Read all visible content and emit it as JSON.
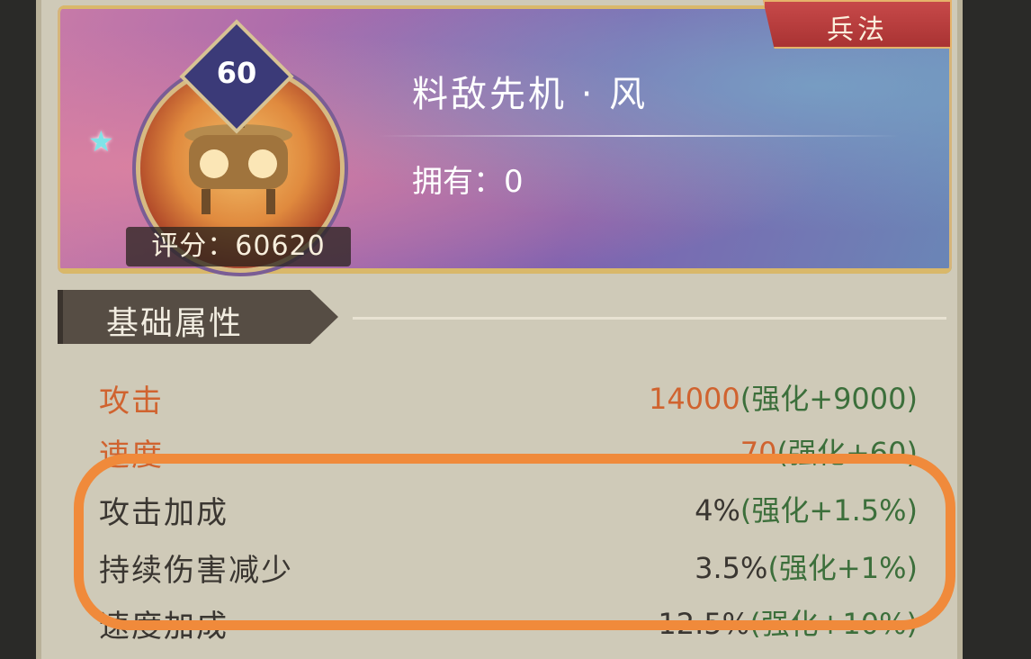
{
  "header": {
    "tag_label": "兵法",
    "level": "60",
    "score_label": "评分：60620",
    "title": "料敌先机 · 风",
    "owned_label": "拥有：0"
  },
  "section": {
    "title": "基础属性"
  },
  "stats": [
    {
      "label": "攻击",
      "value": "14000",
      "bonus": "(强化+9000)"
    },
    {
      "label": "速度",
      "value": "70",
      "bonus": "(强化+60)"
    },
    {
      "label": "攻击加成",
      "value": "4%",
      "bonus": "(强化+1.5%)"
    },
    {
      "label": "持续伤害减少",
      "value": "3.5%",
      "bonus": "(强化+1%)"
    },
    {
      "label": "速度加成",
      "value": "12.5%",
      "bonus": "(强化+10%)"
    }
  ],
  "colors": {
    "primary_stat": "#d0632f",
    "secondary_stat": "#3a3631",
    "bonus": "#3c6f3b",
    "annotation": "#f08a3b"
  }
}
